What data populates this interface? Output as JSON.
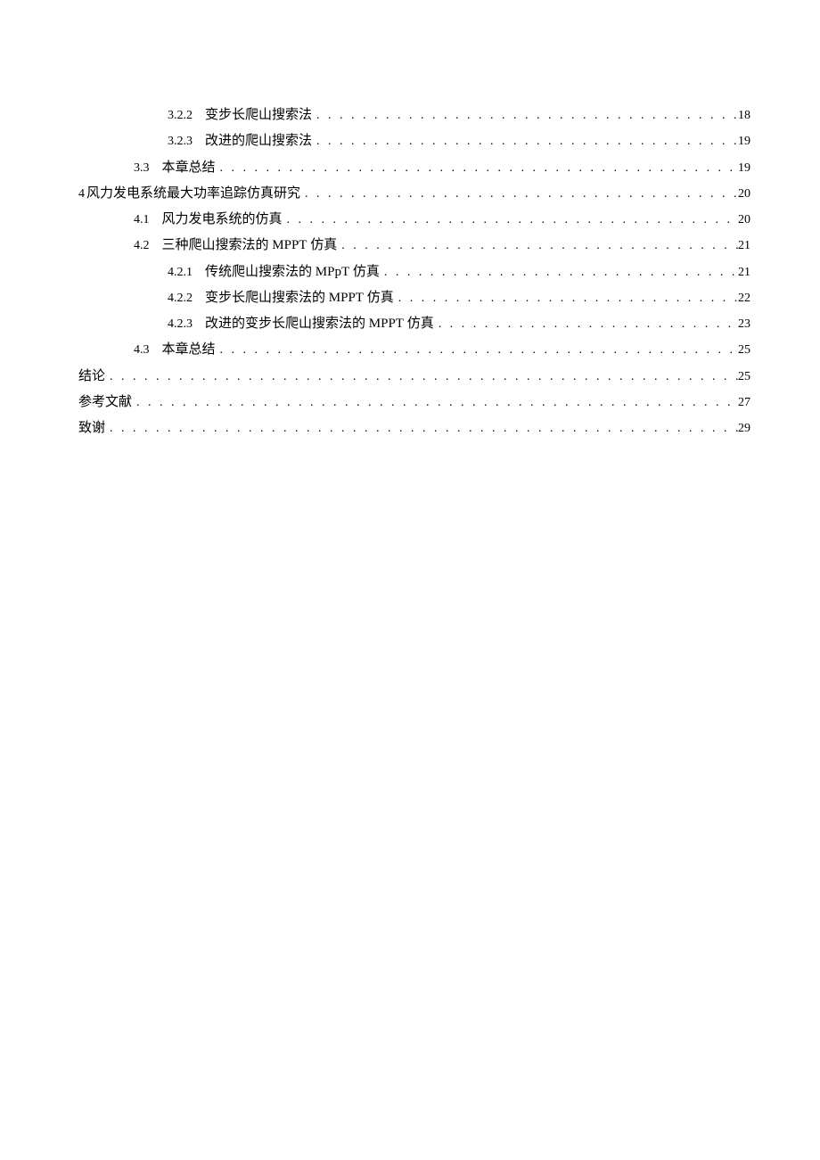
{
  "toc": [
    {
      "indent": 2,
      "num": "3.2.2",
      "title": "变步长爬山搜索法",
      "page": "18"
    },
    {
      "indent": 2,
      "num": "3.2.3",
      "title": "改进的爬山搜索法",
      "page": "19"
    },
    {
      "indent": 1,
      "num": "3.3",
      "title": "本章总结",
      "page": "19"
    },
    {
      "indent": 0,
      "num": "4",
      "title": "风力发电系统最大功率追踪仿真研究",
      "page": "20"
    },
    {
      "indent": 1,
      "num": "4.1",
      "title": "风力发电系统的仿真",
      "page": "20"
    },
    {
      "indent": 1,
      "num": "4.2",
      "title": "三种爬山搜索法的 MPPT 仿真",
      "page": "21"
    },
    {
      "indent": 2,
      "num": "4.2.1",
      "title": "传统爬山搜索法的 MPpT 仿真",
      "page": "21"
    },
    {
      "indent": 2,
      "num": "4.2.2",
      "title": "变步长爬山搜索法的 MPPT 仿真",
      "page": "22"
    },
    {
      "indent": 2,
      "num": "4.2.3",
      "title": "改进的变步长爬山搜索法的 MPPT 仿真",
      "page": "23"
    },
    {
      "indent": 1,
      "num": "4.3",
      "title": "本章总结",
      "page": "25"
    },
    {
      "indent": 0,
      "num": "",
      "title": "结论",
      "page": "25"
    },
    {
      "indent": 0,
      "num": "",
      "title": "参考文献",
      "page": "27"
    },
    {
      "indent": 0,
      "num": "",
      "title": "致谢",
      "page": "29"
    }
  ],
  "dots": ". . . . . . . . . . . . . . . . . . . . . . . . . . . . . . . . . . . . . . . . . . . . . . . . . . . . . . . . . . . . . . . . . . . . . . . . . . . . . . . . . . . . . . . . . . . . . . . . . . . . . . . . . . . . . . . . . . . . . . . . ."
}
